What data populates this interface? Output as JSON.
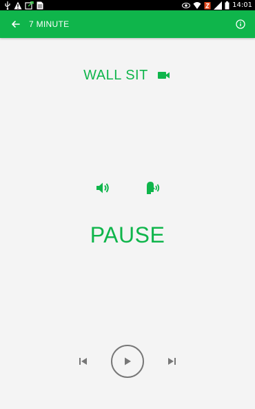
{
  "status_bar": {
    "time": "14:01",
    "left_icons": [
      "usb-icon",
      "warning-icon",
      "sync-icon",
      "document-icon"
    ],
    "right_icons": [
      "eye-icon",
      "wifi-icon",
      "alarm-icon",
      "signal-icon",
      "battery-icon"
    ]
  },
  "app_bar": {
    "title": "7 MINUTE",
    "back_icon": "arrow-back-icon",
    "info_icon": "info-icon",
    "background": "#0fb54b"
  },
  "exercise": {
    "name": "WALL SIT",
    "video_icon": "videocam-icon"
  },
  "controls": {
    "sound_icon": "volume-icon",
    "voice_icon": "voice-icon",
    "pause_label": "PAUSE",
    "previous_icon": "skip-previous-icon",
    "play_icon": "play-icon",
    "next_icon": "skip-next-icon"
  },
  "colors": {
    "accent": "#0fb54b",
    "background": "#f4f4f4",
    "control_gray": "#777777"
  }
}
